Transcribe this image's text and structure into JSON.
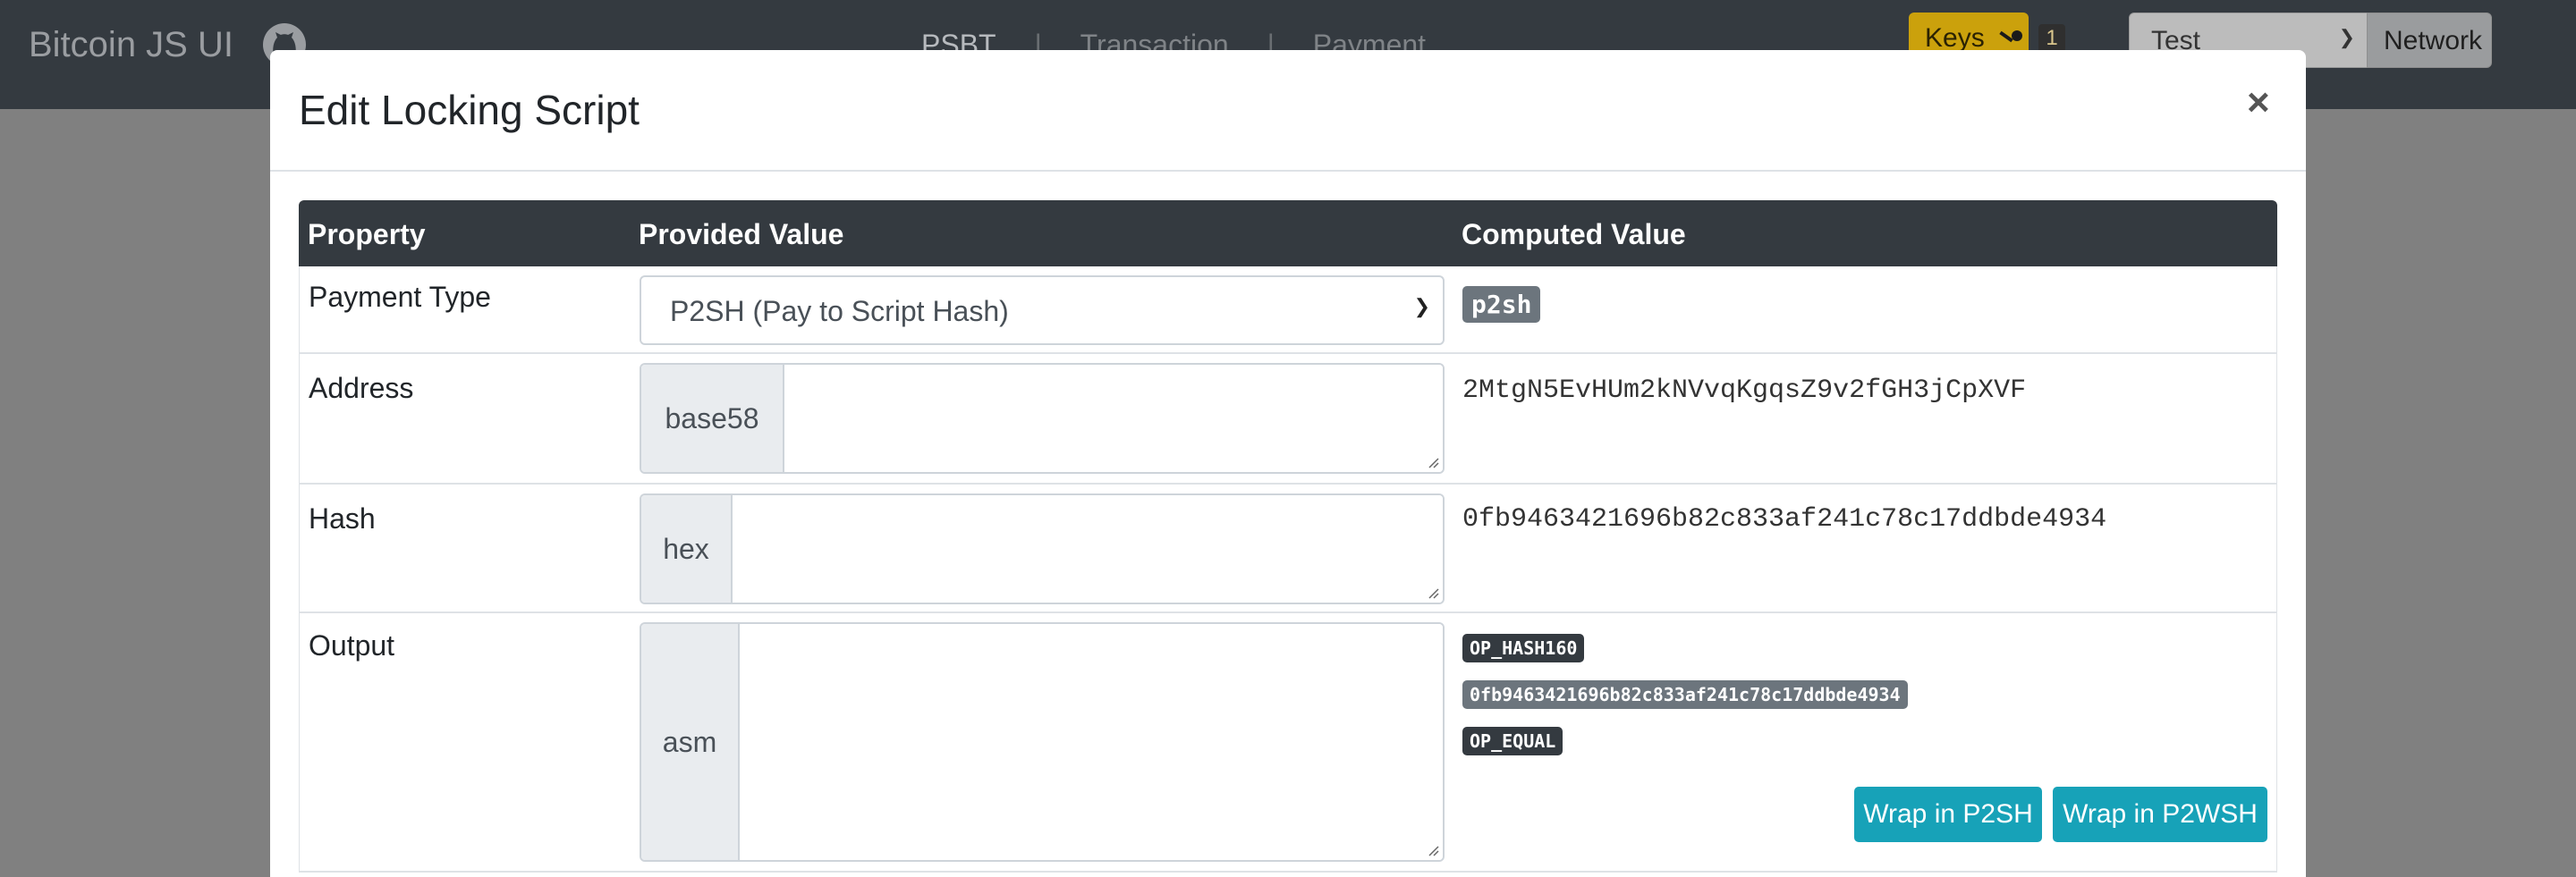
{
  "navbar": {
    "brand": "Bitcoin JS UI",
    "links": [
      "PSBT",
      "Transaction",
      "Payment"
    ],
    "keys_label": "Keys",
    "keys_count": "1",
    "network_selected": "Test",
    "network_button": "Network"
  },
  "modal": {
    "title": "Edit Locking Script",
    "close": "×",
    "headers": {
      "property": "Property",
      "provided": "Provided Value",
      "computed": "Computed Value"
    },
    "payment_type": {
      "label": "Payment Type",
      "selected": "P2SH (Pay to Script Hash)",
      "computed": "p2sh"
    },
    "address": {
      "label": "Address",
      "addon": "base58",
      "value": "",
      "computed": "2MtgN5EvHUm2kNVvqKgqsZ9v2fGH3jCpXVF"
    },
    "hash": {
      "label": "Hash",
      "addon": "hex",
      "value": "",
      "computed": "0fb9463421696b82c833af241c78c17ddbde4934"
    },
    "output": {
      "label": "Output",
      "addon": "asm",
      "value": "",
      "ops": [
        "OP_HASH160",
        "0fb9463421696b82c833af241c78c17ddbde4934",
        "OP_EQUAL"
      ],
      "wrap_p2sh": "Wrap in P2SH",
      "wrap_p2wsh": "Wrap in P2WSH"
    }
  },
  "colors": {
    "navbar": "#343a40",
    "warning": "#cba10c",
    "info": "#17a2b8",
    "secondary": "#6c757d",
    "dark": "#343a40"
  }
}
